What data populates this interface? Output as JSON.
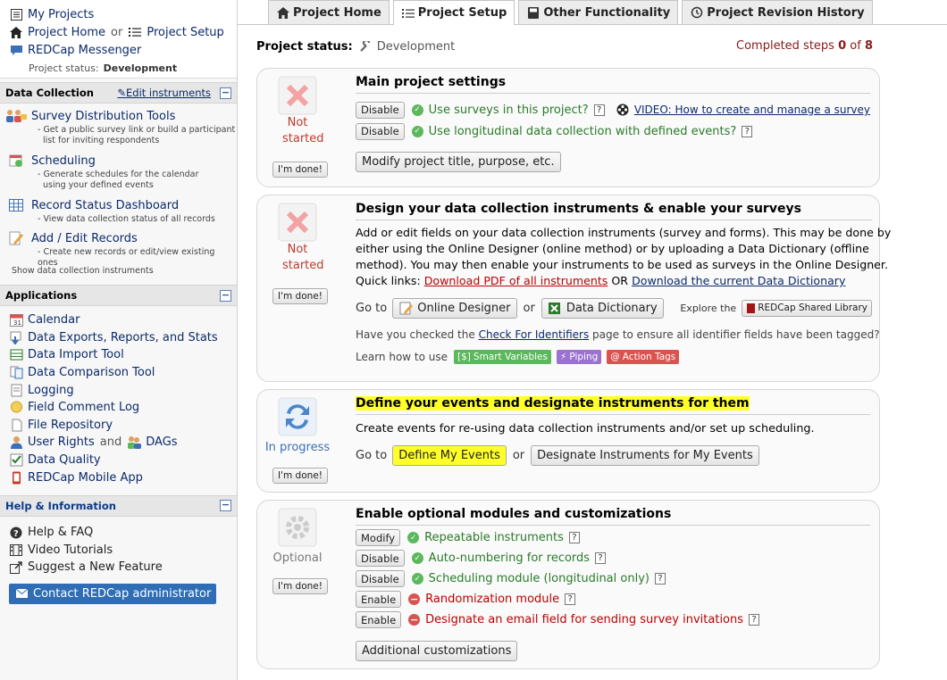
{
  "sidebar": {
    "my_projects": "My Projects",
    "project_home": "Project Home",
    "or": "or",
    "project_setup": "Project Setup",
    "messenger": "REDCap Messenger",
    "status_label": "Project status:",
    "status_value": "Development",
    "data_collection": {
      "title": "Data Collection",
      "edit_instruments": "Edit instruments",
      "items": [
        {
          "label": "Survey Distribution Tools",
          "desc1": "- Get a public survey link or build a participant",
          "desc2": "list for inviting respondents"
        },
        {
          "label": "Scheduling",
          "desc1": "- Generate schedules for the calendar",
          "desc2": "using your defined events"
        },
        {
          "label": "Record Status Dashboard",
          "desc1": "- View data collection status of all records"
        },
        {
          "label": "Add / Edit Records",
          "desc1": "- Create new records or edit/view existing ones"
        }
      ],
      "show_instruments": "Show data collection instruments"
    },
    "applications": {
      "title": "Applications",
      "items": [
        "Calendar",
        "Data Exports, Reports, and Stats",
        "Data Import Tool",
        "Data Comparison Tool",
        "Logging",
        "Field Comment Log",
        "File Repository",
        "Data Quality",
        "REDCap Mobile App"
      ],
      "user_rights": "User Rights",
      "and": "and",
      "dags": "DAGs"
    },
    "help": {
      "title": "Help & Information",
      "items": [
        "Help & FAQ",
        "Video Tutorials",
        "Suggest a New Feature"
      ],
      "contact": "Contact REDCap administrator"
    }
  },
  "tabs": [
    "Project Home",
    "Project Setup",
    "Other Functionality",
    "Project Revision History"
  ],
  "project_status": {
    "label": "Project status:",
    "value": "Development",
    "completed_label": "Completed steps",
    "completed": "0",
    "of": "of",
    "total": "8"
  },
  "cards": {
    "main": {
      "status": "Not started",
      "done": "I'm done!",
      "title": "Main project settings",
      "disable": "Disable",
      "opt1": "Use surveys in this project?",
      "opt2": "Use longitudinal data collection with defined events?",
      "video": "VIDEO: How to create and manage a survey",
      "modify": "Modify project title, purpose, etc."
    },
    "design": {
      "status": "Not started",
      "done": "I'm done!",
      "title": "Design your data collection instruments & enable your surveys",
      "p1": "Add or edit fields on your data collection instruments (survey and forms). This may be done by",
      "p2": "either using the Online Designer (online method) or by uploading a Data Dictionary (offline",
      "p3": "method). You may then enable your instruments to be used as surveys in the Online Designer.",
      "quick": "Quick links:",
      "pdf": "Download PDF of all instruments",
      "or_upper": "OR",
      "dd": "Download the current Data Dictionary",
      "goto": "Go to",
      "online_designer": "Online Designer",
      "or": "or",
      "data_dictionary": "Data Dictionary",
      "explore": "Explore the",
      "shared_library": "REDCap Shared Library",
      "check_pre": "Have you checked the",
      "check_link": "Check For Identifiers",
      "check_post": "page to ensure all identifier fields have been tagged?",
      "learn": "Learn how to use",
      "smart": "Smart Variables",
      "piping": "Piping",
      "action_tags": "Action Tags"
    },
    "events": {
      "status": "In progress",
      "done": "I'm done!",
      "title": "Define your events and designate instruments for them",
      "desc": "Create events for re-using data collection instruments and/or set up scheduling.",
      "goto": "Go to",
      "define": "Define My Events",
      "or": "or",
      "designate": "Designate Instruments for My Events"
    },
    "optional": {
      "status": "Optional",
      "done": "I'm done!",
      "title": "Enable optional modules and customizations",
      "rows": [
        {
          "btn": "Modify",
          "label": "Repeatable instruments",
          "on": true
        },
        {
          "btn": "Disable",
          "label": "Auto-numbering for records",
          "on": true
        },
        {
          "btn": "Disable",
          "label": "Scheduling module (longitudinal only)",
          "on": true
        },
        {
          "btn": "Enable",
          "label": "Randomization module",
          "on": false
        },
        {
          "btn": "Enable",
          "label": "Designate an email field for sending survey invitations",
          "on": false
        }
      ],
      "additional": "Additional customizations"
    }
  },
  "colors": {
    "accent": "#0b2a6b",
    "contact_bg": "#2f6eb5",
    "highlight": "#ffff2a",
    "status_red": "#c0392b"
  }
}
